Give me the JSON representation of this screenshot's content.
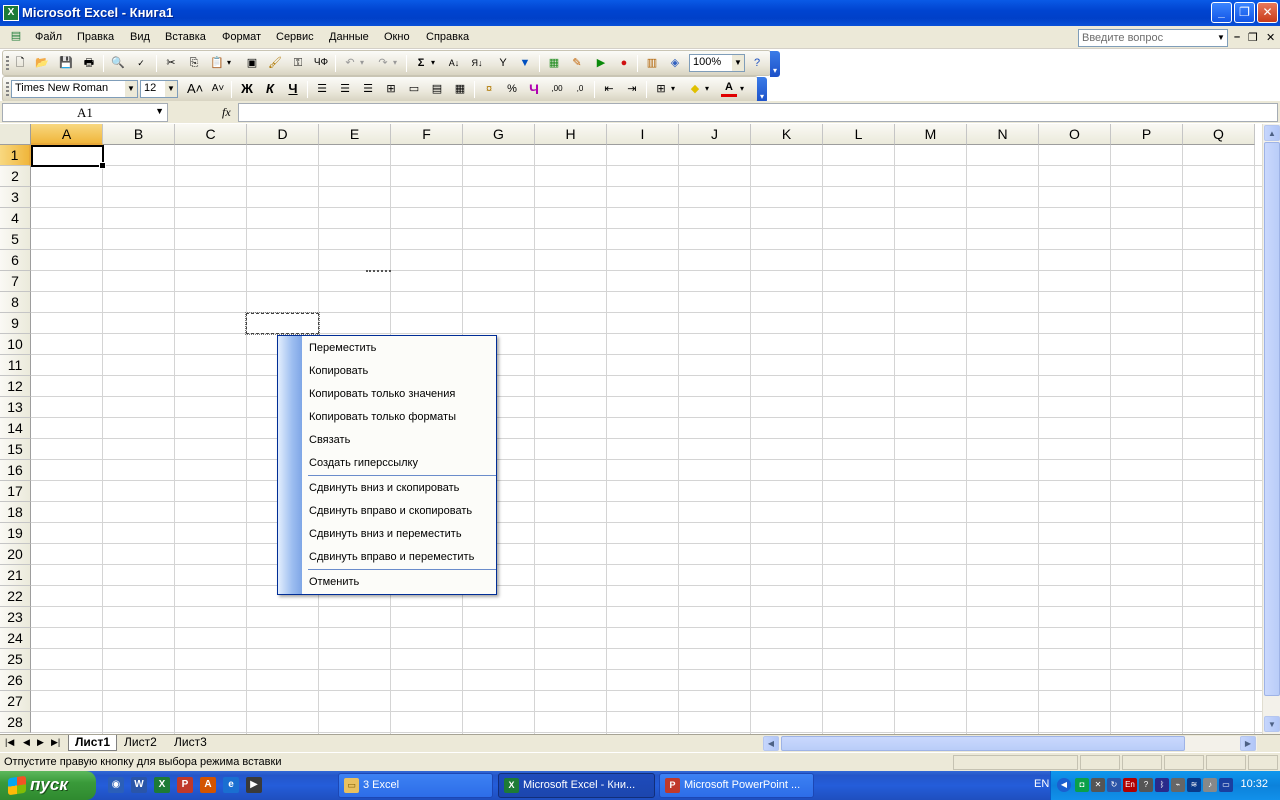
{
  "window": {
    "title": "Microsoft Excel - Книга1",
    "app_icon": "excel-icon"
  },
  "menu": {
    "items": [
      "Файл",
      "Правка",
      "Вид",
      "Вставка",
      "Формат",
      "Сервис",
      "Данные",
      "Окно",
      "Справка"
    ],
    "help_placeholder": "Введите вопрос"
  },
  "standard_toolbar": {
    "zoom": "100%"
  },
  "formatting_toolbar": {
    "font": "Times New Roman",
    "size": "12",
    "bold": "Ж",
    "italic": "К",
    "underline": "Ч",
    "percent": "%"
  },
  "formula_bar": {
    "name_box": "A1",
    "fx": "fx",
    "formula": ""
  },
  "grid": {
    "columns": [
      "A",
      "B",
      "C",
      "D",
      "E",
      "F",
      "G",
      "H",
      "I",
      "J",
      "K",
      "L",
      "M",
      "N",
      "O",
      "P",
      "Q"
    ],
    "rows": [
      "1",
      "2",
      "3",
      "4",
      "5",
      "6",
      "7",
      "8",
      "9",
      "10",
      "11",
      "12",
      "13",
      "14",
      "15",
      "16",
      "17",
      "18",
      "19",
      "20",
      "21",
      "22",
      "23",
      "24",
      "25",
      "26",
      "27",
      "28"
    ],
    "active_cell": "A1"
  },
  "context_menu": {
    "items": [
      {
        "label": "Переместить"
      },
      {
        "label": "Копировать"
      },
      {
        "label": "Копировать только значения"
      },
      {
        "label": "Копировать только форматы"
      },
      {
        "label": "Связать"
      },
      {
        "label": "Создать гиперссылку"
      },
      {
        "label": "Сдвинуть вниз и скопировать"
      },
      {
        "label": "Сдвинуть вправо и скопировать"
      },
      {
        "label": "Сдвинуть вниз и переместить"
      },
      {
        "label": "Сдвинуть вправо и переместить"
      },
      {
        "label": "Отменить"
      }
    ]
  },
  "sheets": {
    "tabs": [
      "Лист1",
      "Лист2",
      "Лист3"
    ],
    "active": "Лист1"
  },
  "status": {
    "text": "Отпустите правую кнопку для выбора режима вставки"
  },
  "taskbar": {
    "start_label": "пуск",
    "tasks": [
      {
        "label": "3 Excel"
      },
      {
        "label": "Microsoft Excel - Кни..."
      },
      {
        "label": "Microsoft PowerPoint ..."
      }
    ],
    "language": "EN",
    "clock": "10:32"
  },
  "colors": {
    "titlebar": "#0a5ae6",
    "selection_header": "#f0b63c",
    "menu_border": "#002d96",
    "taskbar": "#245dda"
  }
}
